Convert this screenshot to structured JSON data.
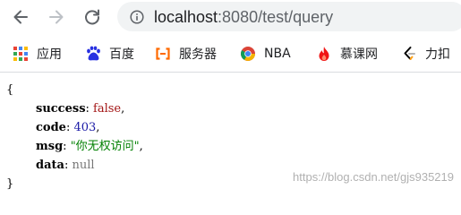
{
  "toolbar": {
    "url_host": "localhost",
    "url_rest": ":8080/test/query"
  },
  "bookmarks": [
    {
      "label": "应用",
      "icon": "apps-grid-icon"
    },
    {
      "label": "百度",
      "icon": "baidu-paw-icon"
    },
    {
      "label": "服务器",
      "icon": "aliyun-icon"
    },
    {
      "label": "NBA",
      "icon": "nba-chrome-icon"
    },
    {
      "label": "慕课网",
      "icon": "mooc-flame-icon"
    },
    {
      "label": "力扣",
      "icon": "leetcode-icon"
    }
  ],
  "json_view": {
    "open_brace": "{",
    "close_brace": "}",
    "fields": [
      {
        "key": "success",
        "value": "false"
      },
      {
        "key": "code",
        "value": "403"
      },
      {
        "key": "msg",
        "value": "\"你无权访问\""
      },
      {
        "key": "data",
        "value": "null"
      }
    ]
  },
  "watermark": "https://blog.csdn.net/gjs935219",
  "colors": {
    "bool": "#a31515",
    "number": "#1a1aa6",
    "string": "#008000",
    "null": "#767676"
  }
}
